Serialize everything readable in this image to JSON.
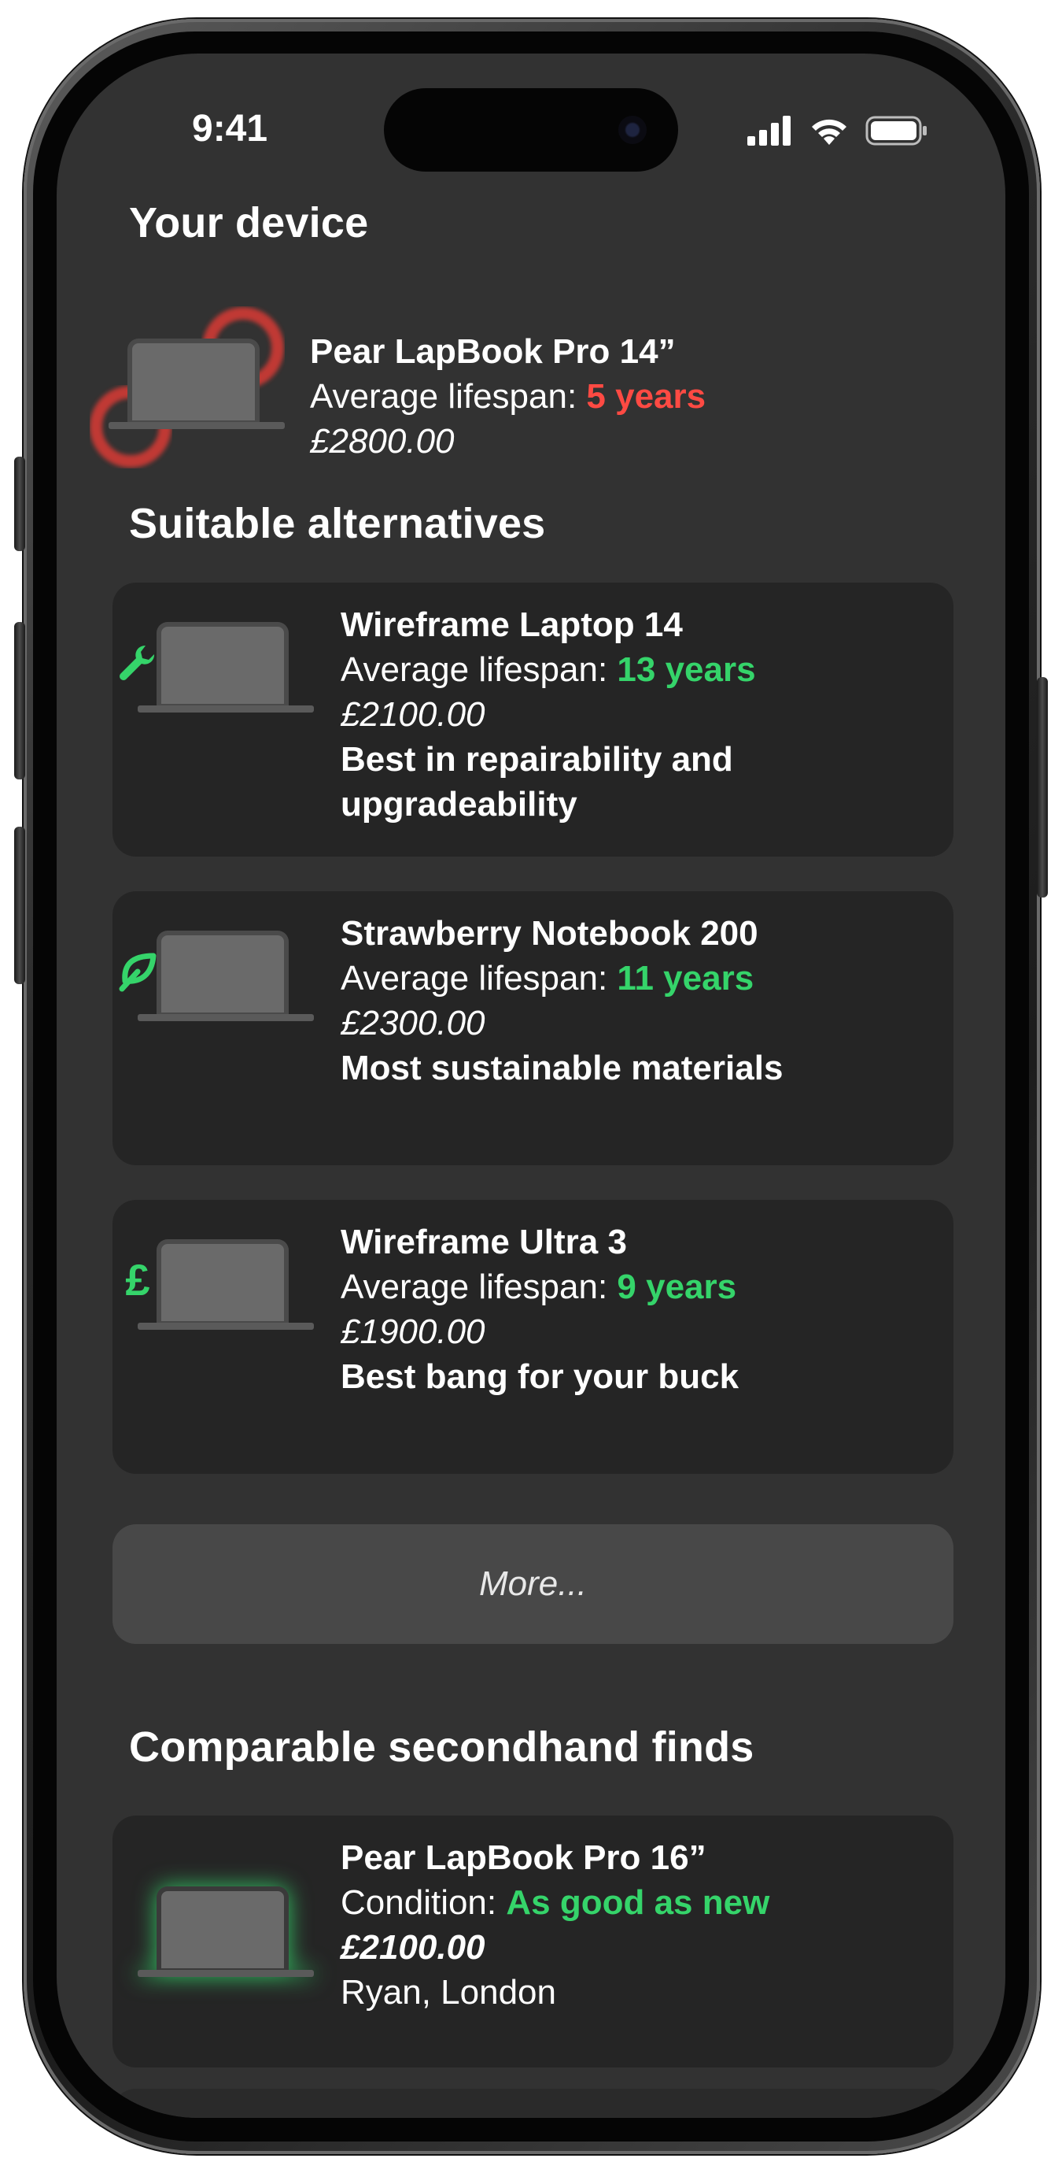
{
  "status_bar": {
    "time": "9:41",
    "icons": [
      "cellular-signal-icon",
      "wifi-icon",
      "battery-icon"
    ]
  },
  "your_device": {
    "heading": "Your device",
    "name": "Pear LapBook Pro 14”",
    "lifespan_label": "Average lifespan: ",
    "lifespan_value": "5 years",
    "price": "£2800.00",
    "icon": "laptop-icon",
    "status_color": "#ff4a43"
  },
  "alternatives": {
    "heading": "Suitable alternatives",
    "items": [
      {
        "name": "Wireframe Laptop 14",
        "lifespan_label": "Average lifespan: ",
        "lifespan_value": "13 years",
        "price": "£2100.00",
        "tagline_1": "Best in repairability and",
        "tagline_2": "upgradeability",
        "icon": "wrench-icon",
        "glyph": "🔧"
      },
      {
        "name": "Strawberry Notebook 200",
        "lifespan_label": "Average lifespan: ",
        "lifespan_value": "11 years",
        "price": "£2300.00",
        "tagline_1": "Most sustainable materials",
        "icon": "leaf-icon",
        "glyph": "🍃"
      },
      {
        "name": "Wireframe Ultra 3",
        "lifespan_label": "Average lifespan: ",
        "lifespan_value": "9 years",
        "price": "£1900.00",
        "tagline_1": "Best bang for your buck",
        "icon": "pound-icon",
        "glyph": "£"
      }
    ],
    "more_label": "More..."
  },
  "secondhand": {
    "heading": "Comparable secondhand finds",
    "items": [
      {
        "name": "Pear LapBook Pro 16”",
        "condition_label": "Condition: ",
        "condition_value": "As good as new",
        "price": "£2100.00",
        "seller": "Ryan, London",
        "icon": "laptop-icon"
      }
    ]
  },
  "colors": {
    "background": "#323232",
    "card": "#252525",
    "button": "#484848",
    "positive": "#35d46a",
    "negative": "#ff4a43"
  }
}
